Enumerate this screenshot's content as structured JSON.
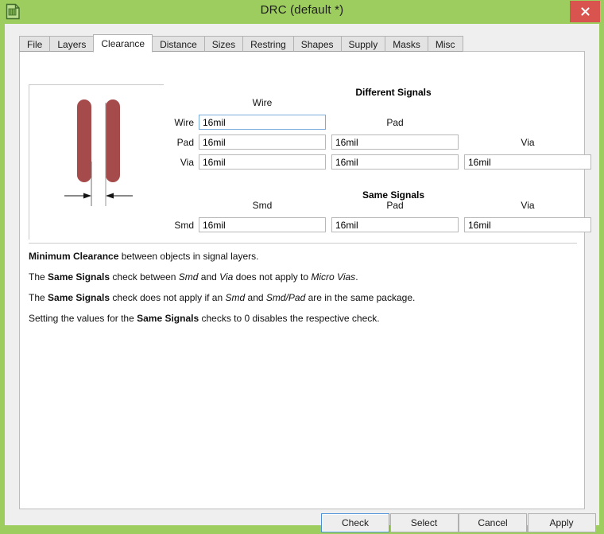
{
  "window": {
    "title": "DRC (default *)",
    "icon": "board-document-icon",
    "close_label": "✕",
    "frame_color": "#9ccd5e",
    "close_color": "#d9534f"
  },
  "tabs": [
    {
      "label": "File",
      "active": false
    },
    {
      "label": "Layers",
      "active": false
    },
    {
      "label": "Clearance",
      "active": true
    },
    {
      "label": "Distance",
      "active": false
    },
    {
      "label": "Sizes",
      "active": false
    },
    {
      "label": "Restring",
      "active": false
    },
    {
      "label": "Shapes",
      "active": false
    },
    {
      "label": "Supply",
      "active": false
    },
    {
      "label": "Masks",
      "active": false
    },
    {
      "label": "Misc",
      "active": false
    }
  ],
  "preview": {
    "name": "clearance-preview-diagram",
    "trace_color": "#a64b4b",
    "line_color": "#7f7f7f",
    "arrow_color": "#1a1a1a"
  },
  "different_signals": {
    "title": "Different Signals",
    "col_headers": [
      "Wire",
      "Pad",
      "Via"
    ],
    "row_labels": [
      "Wire",
      "Pad",
      "Via"
    ],
    "values": [
      [
        "16mil",
        null,
        null
      ],
      [
        "16mil",
        "16mil",
        null
      ],
      [
        "16mil",
        "16mil",
        "16mil"
      ]
    ],
    "focused_cell": [
      0,
      0
    ]
  },
  "same_signals": {
    "title": "Same Signals",
    "col_headers": [
      "Smd",
      "Pad",
      "Via"
    ],
    "row_labels": [
      "Smd"
    ],
    "values": [
      [
        "16mil",
        "16mil",
        "16mil"
      ]
    ]
  },
  "notes": [
    {
      "parts": [
        {
          "t": "Minimum Clearance",
          "s": "b"
        },
        {
          "t": " between objects in signal layers.",
          "s": "n"
        }
      ]
    },
    {
      "parts": [
        {
          "t": "The ",
          "s": "n"
        },
        {
          "t": "Same Signals",
          "s": "b"
        },
        {
          "t": " check between ",
          "s": "n"
        },
        {
          "t": "Smd",
          "s": "i"
        },
        {
          "t": " and ",
          "s": "n"
        },
        {
          "t": "Via",
          "s": "i"
        },
        {
          "t": " does not apply to ",
          "s": "n"
        },
        {
          "t": "Micro Vias",
          "s": "i"
        },
        {
          "t": ".",
          "s": "n"
        }
      ]
    },
    {
      "parts": [
        {
          "t": "The ",
          "s": "n"
        },
        {
          "t": "Same Signals",
          "s": "b"
        },
        {
          "t": " check does not apply if an ",
          "s": "n"
        },
        {
          "t": "Smd",
          "s": "i"
        },
        {
          "t": " and ",
          "s": "n"
        },
        {
          "t": "Smd/Pad",
          "s": "i"
        },
        {
          "t": " are in the same package.",
          "s": "n"
        }
      ]
    },
    {
      "parts": [
        {
          "t": "Setting the values for the ",
          "s": "n"
        },
        {
          "t": "Same Signals",
          "s": "b"
        },
        {
          "t": " checks to 0 disables the respective check.",
          "s": "n"
        }
      ]
    }
  ],
  "buttons": [
    {
      "label": "Check",
      "default": true
    },
    {
      "label": "Select",
      "default": false
    },
    {
      "label": "Cancel",
      "default": false
    },
    {
      "label": "Apply",
      "default": false
    }
  ]
}
